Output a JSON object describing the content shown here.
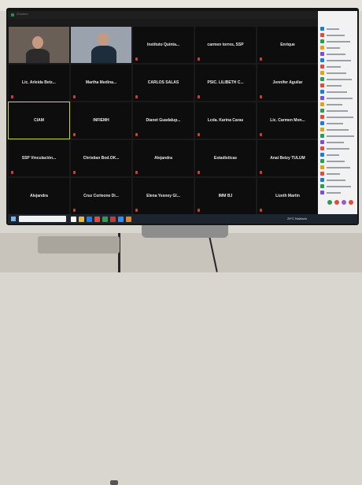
{
  "window": {
    "title_fragment": "Zoomen"
  },
  "colors": {
    "tile_bg": "#0d0d0d",
    "active_border": "#c6d63a",
    "muted_mic": "#d23c3c",
    "chat_bg": "#f2f2f2",
    "taskbar_bg": "#1c2430"
  },
  "participants": [
    {
      "name": "",
      "video": true,
      "muted": false
    },
    {
      "name": "",
      "video": true,
      "muted": false
    },
    {
      "name": "Instituto Quinta...",
      "muted": true
    },
    {
      "name": "carmen torres, SSP",
      "muted": true
    },
    {
      "name": "Enrique",
      "muted": true
    },
    {
      "name": "Lic. Arleida Betz...",
      "muted": true
    },
    {
      "name": "Martha Medina...",
      "muted": true
    },
    {
      "name": "CARLOS SALAS",
      "muted": true
    },
    {
      "name": "PSIC. LILIBETH C...",
      "muted": true
    },
    {
      "name": "Jennifer Aguilar",
      "muted": true
    },
    {
      "name": "CIAM",
      "muted": false,
      "active": true
    },
    {
      "name": "INFIEMH",
      "muted": true
    },
    {
      "name": "Dianet Guadalup...",
      "muted": true
    },
    {
      "name": "Lcda. Karina Caras",
      "muted": true
    },
    {
      "name": "Lic. Carmen Mon...",
      "muted": true
    },
    {
      "name": "SSP Vinculación...",
      "muted": true
    },
    {
      "name": "Christian Bod.OK...",
      "muted": true
    },
    {
      "name": "Alejandra",
      "muted": true
    },
    {
      "name": "Estadísticas",
      "muted": true
    },
    {
      "name": "Anai Betzy TULUM",
      "muted": true
    },
    {
      "name": "Alejandra",
      "muted": false
    },
    {
      "name": "Cruz Corleone Di...",
      "muted": true
    },
    {
      "name": "Elena Yesney Gl...",
      "muted": true
    },
    {
      "name": "IMM BJ",
      "muted": true
    },
    {
      "name": "Lizeth Martín",
      "muted": true
    }
  ],
  "chat_panel": {
    "item_count_note": "participant list with colored avatars",
    "avatar_colors": [
      "#1f7ae0",
      "#e04b3b",
      "#2e9b53",
      "#e0a21f",
      "#7b4ce0",
      "#1f7ae0",
      "#e04b3b",
      "#e0a21f",
      "#2e9b53",
      "#e04b3b",
      "#1f7ae0",
      "#7b4ce0",
      "#e0a21f",
      "#2e9b53",
      "#e04b3b",
      "#1f7ae0",
      "#e0a21f",
      "#2e9b53",
      "#7b4ce0",
      "#e04b3b",
      "#1f7ae0",
      "#2e9b53",
      "#e0a21f",
      "#e04b3b",
      "#1f7ae0",
      "#2e9b53",
      "#7b4ce0"
    ]
  },
  "taskbar": {
    "tray_text": "29°C  Nublado"
  }
}
